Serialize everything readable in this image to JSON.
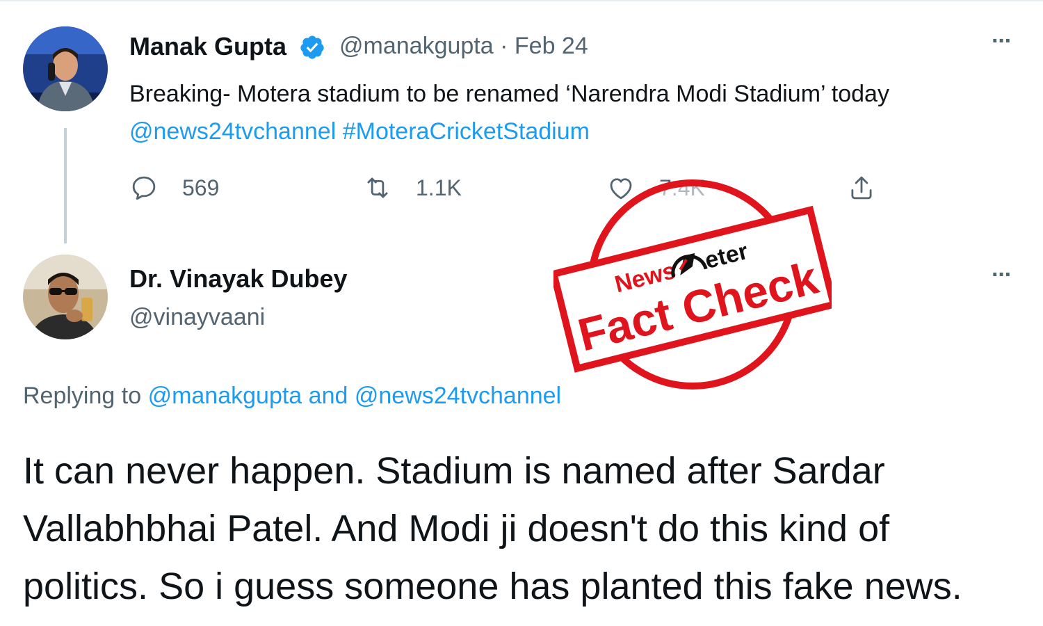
{
  "tweet1": {
    "author_name": "Manak Gupta",
    "verified_icon": "verified-badge-icon",
    "handle": "@manakgupta",
    "separator": "·",
    "date": "Feb 24",
    "text_prefix": "Breaking- Motera stadium to be renamed ‘Narendra Modi Stadium’ today",
    "mention": "@news24tvchannel",
    "hashtag": "#MoteraCricketStadium",
    "more_label": "···",
    "actions": {
      "reply_count": "569",
      "retweet_count": "1.1K",
      "like_count": "7.4K",
      "icons": [
        "reply-icon",
        "retweet-icon",
        "like-icon",
        "share-icon"
      ]
    }
  },
  "tweet2": {
    "author_name": "Dr. Vinayak Dubey",
    "handle": "@vinayvaani",
    "more_label": "···",
    "replying_prefix": "Replying to",
    "replying_user1": "@manakgupta",
    "replying_and": "and",
    "replying_user2": "@news24tvchannel",
    "body": "It can never happen. Stadium is named after Sardar Vallabhbhai Patel. And Modi ji doesn't do this kind of politics. So i guess someone has planted this fake news."
  },
  "stamp": {
    "brand_part1": "News",
    "brand_part2": "eter",
    "label": "Fact Check",
    "color": "#e0141c"
  },
  "colors": {
    "link": "#1d9bf0",
    "secondary_text": "#536471",
    "primary_text": "#0f1419"
  }
}
